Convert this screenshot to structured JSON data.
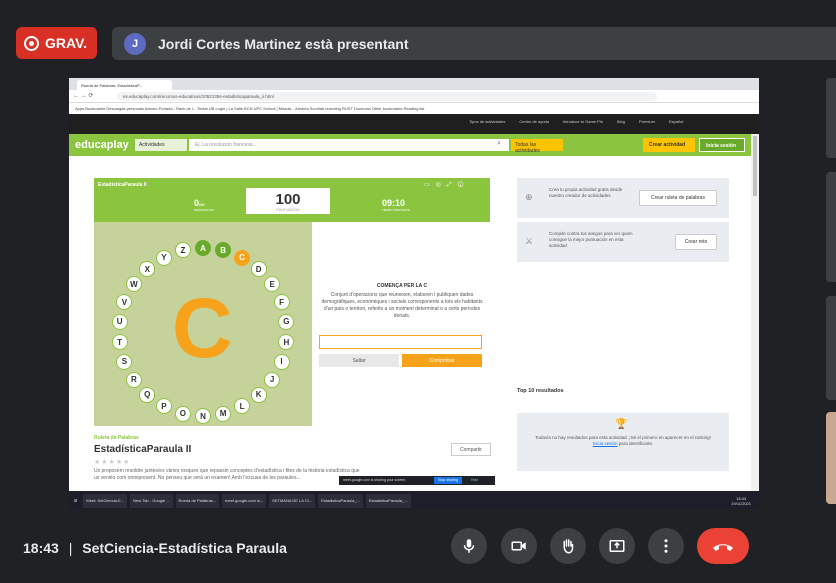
{
  "meet": {
    "recording_label": "GRAV.",
    "presenter_initial": "J",
    "presenter_text": "Jordi Cortes Martinez està presentant",
    "time": "18:43",
    "separator": "|",
    "meeting_name": "SetCiencia-Estadística Paraula",
    "controls": [
      "mic-icon",
      "camera-icon",
      "raise-hand-icon",
      "present-icon",
      "more-icon",
      "end-call-icon"
    ]
  },
  "browser": {
    "tab_title": "Rueda de Palabras: EstadísticaP...",
    "url": "es.educaplay.com/recursos-educativos/10521394-estadisticaparaula_ii.html",
    "bookmarks": "Apps  Bookmarks  Descargas personals  Ateneu  Portada - Rack de l...  Teclat UB  Login | La Salle BCN  UPC School | Mirada...  Almeria  Scrollab remoting  RUST  Docencia  Other bookmarks  Reading list"
  },
  "educaplay": {
    "subnav": [
      "Tipos de actividades",
      "Centro de ayuda",
      "Introduce tu Game Pin",
      "Blog",
      "Premium",
      "Español"
    ],
    "logo": "educaplay",
    "activities_select": "Actividades",
    "search_placeholder": "Ej. La revolución francesa...",
    "all_activities": "Todas las actividades",
    "create_activity": "Crear actividad",
    "login": "Inicia sesión"
  },
  "game": {
    "title": "EstadísticaParaula II",
    "answered": "0",
    "answered_total": "/26",
    "answered_label": "RESPUESTAS",
    "score": "100",
    "score_label": "PUNTUACIÓN",
    "timer": "09:10",
    "timer_label": "TIEMPO RESTANTE",
    "current_letter": "C",
    "letters": [
      "A",
      "B",
      "C",
      "D",
      "E",
      "F",
      "G",
      "H",
      "I",
      "J",
      "K",
      "L",
      "M",
      "N",
      "O",
      "P",
      "Q",
      "R",
      "S",
      "T",
      "U",
      "V",
      "W",
      "X",
      "Y",
      "Z"
    ],
    "done_letters": [
      "A",
      "B"
    ],
    "active_letter": "C",
    "clue_header": "COMENÇA PER LA C",
    "clue": "Conjunt d'operacions que reuneixen, elaboren i publiquen dades demogràfiques, econòmiques i socials corresponents a tots els habitants d'un país o territori, referits a un moment determinat o a certs períodes donats.",
    "skip": "Saltar",
    "check": "Comprobar"
  },
  "activity": {
    "category": "Ruleta de Palabras",
    "title": "EstadísticaParaula II",
    "stars": "★★★★★",
    "description": "Us proposem resoldre juntes/es vàries rosques que repassin conceptes d'estadística i fites de la història estadística que us veniéu com omnipresent. No penseu que serà un examen! Amb l'excusa de les paraules...",
    "share": "Compartir"
  },
  "sidebar": {
    "card1_text": "Crea tu propia actividad gratis desde nuestro creador de actividades",
    "card1_button": "Crear ruleta de palabras",
    "card2_text": "Compite contra tus amigos para ver quien consigue la mejor puntuación en esta actividad",
    "card2_button": "Crear reto",
    "top10": "Top 10 resultados",
    "no_results": "Todavía no hay resultados para esta actividad. ¡Sé el primero en aparecer en el ranking!",
    "login_link": "Inicia sesión",
    "no_results_suffix": "para identificarte."
  },
  "sharing": {
    "text": "meet.google.com is sharing your screen.",
    "stop": "Stop sharing",
    "hide": "Hide"
  },
  "taskbar": {
    "items": [
      "Meet: SetCiencia-E...",
      "New Tab - Google ...",
      "Rueda de Palabras...",
      "meet.google.com is...",
      "SETMANA DE LA CI...",
      "EstadisticaParaula_...",
      "EstadisticaParaula_..."
    ],
    "time": "18:43",
    "date": "19/11/2021"
  }
}
